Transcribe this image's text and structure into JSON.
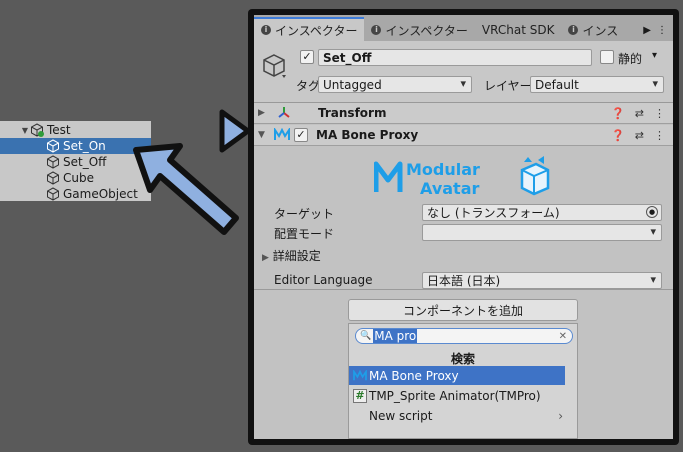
{
  "hierarchy": {
    "items": [
      {
        "label": "Test"
      },
      {
        "label": "Set_On"
      },
      {
        "label": "Set_Off"
      },
      {
        "label": "Cube"
      },
      {
        "label": "GameObject"
      }
    ]
  },
  "tabs": [
    {
      "label": "インスペクター"
    },
    {
      "label": "インスペクター"
    },
    {
      "label": "VRChat SDK"
    },
    {
      "label": "インス"
    }
  ],
  "header": {
    "object_name": "Set_Off",
    "static_label": "静的",
    "tag_label": "タグ",
    "tag_value": "Untagged",
    "layer_label": "レイヤー",
    "layer_value": "Default"
  },
  "components": {
    "transform": "Transform",
    "bone_proxy": "MA Bone Proxy"
  },
  "bone_proxy": {
    "logo_line1": "Modular",
    "logo_line2": "Avatar",
    "target_label": "ターゲット",
    "target_value": "なし (トランスフォーム)",
    "mode_label": "配置モード",
    "mode_value": "",
    "advanced_label": "詳細設定",
    "language_label": "Editor Language",
    "language_value": "日本語 (日本)"
  },
  "add_component": {
    "button_label": "コンポーネントを追加",
    "search_value": "MA pro",
    "results_title": "検索",
    "results": [
      {
        "label": "MA Bone Proxy",
        "icon": "ma-icon"
      },
      {
        "label": "TMP_Sprite Animator",
        "suffix": "(TMPro)",
        "icon": "script-icon"
      },
      {
        "label": "New script",
        "icon": "chevron-right-icon"
      }
    ]
  },
  "colors": {
    "accent": "#3e73c6",
    "arrow_fill": "#8fb0e0",
    "logo_blue": "#1e9ee8"
  }
}
